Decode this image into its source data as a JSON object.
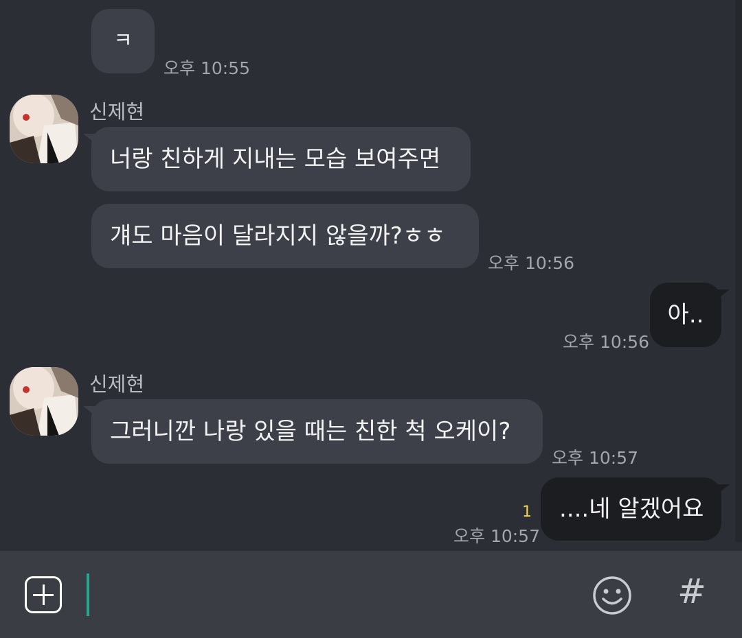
{
  "messages": [
    {
      "text": "ㅋ",
      "time": "오후 10:55"
    },
    {
      "sender": "신제현",
      "text": "너랑 친하게 지내는 모습 보여주면"
    },
    {
      "text": "걔도 마음이 달라지지 않을까?ㅎㅎ",
      "time": "오후 10:56"
    },
    {
      "text": "아..",
      "time": "오후 10:56",
      "mine": true
    },
    {
      "sender": "신제현",
      "text": "그러니깐 나랑 있을 때는 친한 척 오케이?",
      "time": "오후 10:57"
    },
    {
      "text": "....네 알겠어요",
      "time": "오후 10:57",
      "mine": true,
      "unread": "1"
    }
  ],
  "input": {
    "value": ""
  },
  "icons": {
    "attach": "plus-square-icon",
    "emoji": "smiley-icon",
    "hashtag": "hash-icon",
    "hash_glyph": "#"
  },
  "colors": {
    "background": "#2b2e34",
    "incoming_bubble": "#3d4048",
    "outgoing_bubble": "#1c1d21",
    "cursor": "#2aa68f",
    "unread": "#f3d54a"
  }
}
